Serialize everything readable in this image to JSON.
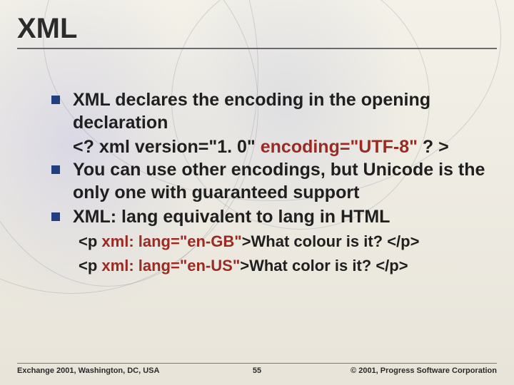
{
  "title": "XML",
  "bullets": [
    {
      "text": "XML declares the encoding in the opening declaration",
      "indent_plain_pre": "<? xml version=\"1. 0\" ",
      "indent_kw": "encoding=\"UTF-8\"",
      "indent_plain_post": " ? >"
    },
    {
      "text": "You can use other encodings, but Unicode is the only one with guaranteed support"
    },
    {
      "text": "XML: lang equivalent to lang in HTML",
      "subs": [
        {
          "pre": "<p ",
          "kw": "xml: lang=\"en-GB\"",
          "post": ">What colour is it? </p>"
        },
        {
          "pre": "<p ",
          "kw": "xml: lang=\"en-US\"",
          "post": ">What color is it? </p>"
        }
      ]
    }
  ],
  "footer": {
    "left": "Exchange 2001, Washington, DC, USA",
    "mid": "55",
    "right": "© 2001, Progress Software Corporation"
  }
}
